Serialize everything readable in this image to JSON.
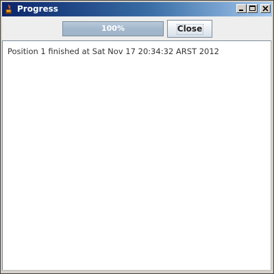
{
  "window": {
    "title": "Progress",
    "icon": "java-cup-icon",
    "buttons": {
      "minimize": "minimize-icon",
      "maximize": "maximize-icon",
      "close": "close-icon"
    }
  },
  "toolbar": {
    "progress": {
      "value": 1.0,
      "text": "100%"
    },
    "close_label": "Close"
  },
  "log": {
    "text": "Position 1 finished at Sat Nov 17 20:34:32 ARST 2012"
  },
  "colors": {
    "titlebar_start": "#0a246a",
    "titlebar_end": "#a6caf0",
    "progress_fill": "#a3b8cc",
    "window_bg": "#eeeeee"
  }
}
